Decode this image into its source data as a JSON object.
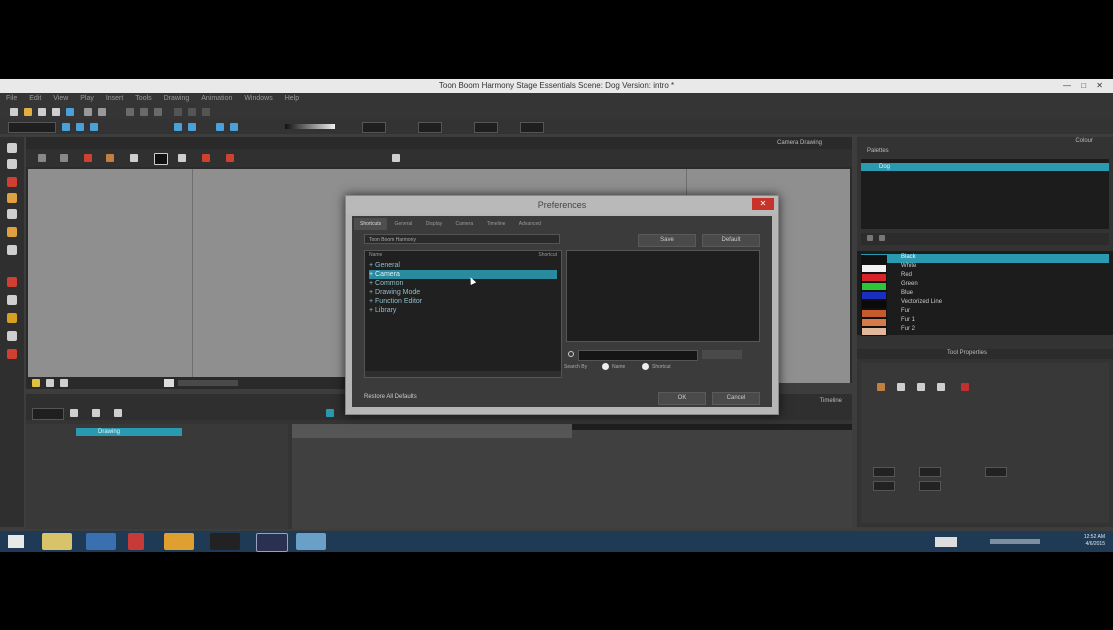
{
  "window": {
    "title": "Toon Boom Harmony Stage Essentials Scene: Dog Version: intro *",
    "controls": "— □ ✕"
  },
  "menu": [
    "File",
    "Edit",
    "View",
    "Play",
    "Insert",
    "Tools",
    "Drawing",
    "Animation",
    "Windows",
    "Help"
  ],
  "view_panel": {
    "tabs_right": "Camera  Drawing"
  },
  "timeline": {
    "tab_label": "Timeline",
    "layer_name": "Drawing"
  },
  "right_panel": {
    "top_tab": "Colour",
    "layers_tab": "Palettes",
    "selected_palette": "Dog",
    "colors": [
      {
        "name": "Black",
        "hex": "#111111",
        "selected": true
      },
      {
        "name": "White",
        "hex": "#f2f2f2"
      },
      {
        "name": "Red",
        "hex": "#d9232b"
      },
      {
        "name": "Green",
        "hex": "#2ec437"
      },
      {
        "name": "Blue",
        "hex": "#1b2fbf"
      },
      {
        "name": "Vectorized Line",
        "hex": "#0a0a0a"
      },
      {
        "name": "Fur",
        "hex": "#c75a2c"
      },
      {
        "name": "Fur 1",
        "hex": "#d67a49"
      },
      {
        "name": "Fur 2",
        "hex": "#e3b89a"
      }
    ],
    "props_tab": "Tool Properties"
  },
  "preferences": {
    "title": "Preferences",
    "close_glyph": "✕",
    "tabs": [
      "Shortcuts",
      "General",
      "Display",
      "Camera",
      "Timeline",
      "Advanced"
    ],
    "active_tab": 0,
    "keyset_value": "Toon Boom Harmony",
    "save_button": "Save",
    "default_button": "Default",
    "list_header_left": "Name",
    "list_header_right": "Shortcut",
    "items": [
      {
        "label": "+ General",
        "selected": false
      },
      {
        "label": "+ Camera",
        "selected": true
      },
      {
        "label": "+ Common",
        "selected": false
      },
      {
        "label": "+ Drawing Mode",
        "selected": false
      },
      {
        "label": "+ Function Editor",
        "selected": false
      },
      {
        "label": "+ Library",
        "selected": false
      }
    ],
    "search_by_label": "Search By",
    "search_option_1": "Name",
    "search_option_2": "Shortcut",
    "restore_label": "Restore All Defaults",
    "ok_button": "OK",
    "cancel_button": "Cancel"
  },
  "taskbar": {
    "time": "12:52 AM",
    "date": "4/6/2015"
  },
  "colors": {
    "accent": "#2a9ab0",
    "canvas": "#8f8f8f",
    "dialog_close": "#c7332b",
    "taskbar": "#1e3a55"
  }
}
